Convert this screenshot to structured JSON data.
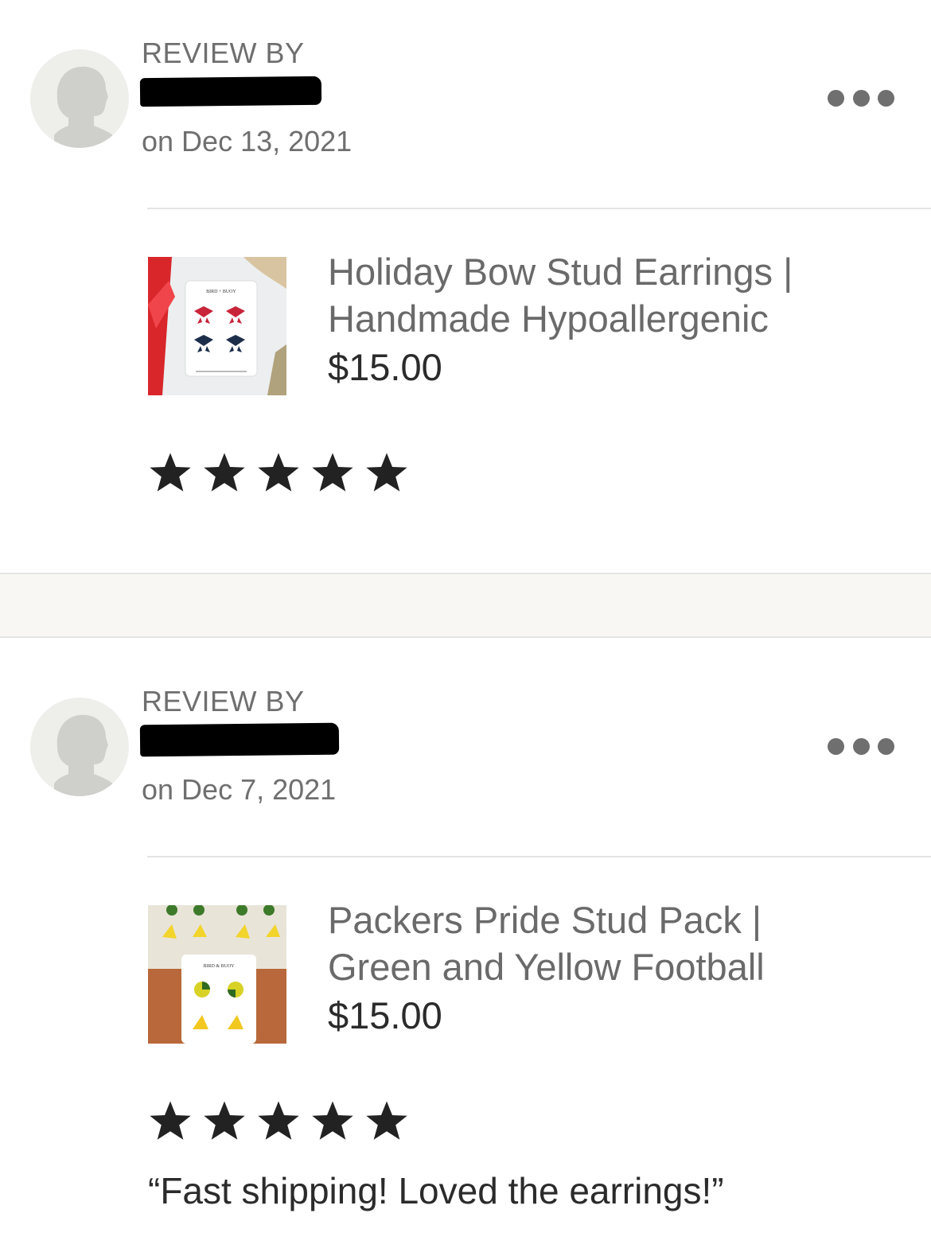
{
  "reviews": [
    {
      "label": "REVIEW BY",
      "date": "on Dec 13, 2021",
      "product_title_line1": "Holiday Bow Stud Earrings |",
      "product_title_line2": "Handmade Hypoallergenic",
      "price": "$15.00",
      "rating": 5,
      "thumbnail_card_text": "BIRD + BUOY"
    },
    {
      "label": "REVIEW BY",
      "date": "on Dec 7, 2021",
      "product_title_line1": "Packers Pride Stud Pack |",
      "product_title_line2": "Green and Yellow Football",
      "price": "$15.00",
      "rating": 5,
      "thumbnail_card_text": "BIRD & BUOY",
      "text": "“Fast shipping! Loved the earrings!”"
    }
  ],
  "icons": {
    "menu": "more-horizontal-icon",
    "avatar": "default-user-avatar-icon",
    "star": "filled-star-icon"
  },
  "colors": {
    "star": "#222222",
    "muted_text": "#6f6f6f",
    "divider": "#e4e4e4",
    "section_gap": "#f8f7f3"
  }
}
